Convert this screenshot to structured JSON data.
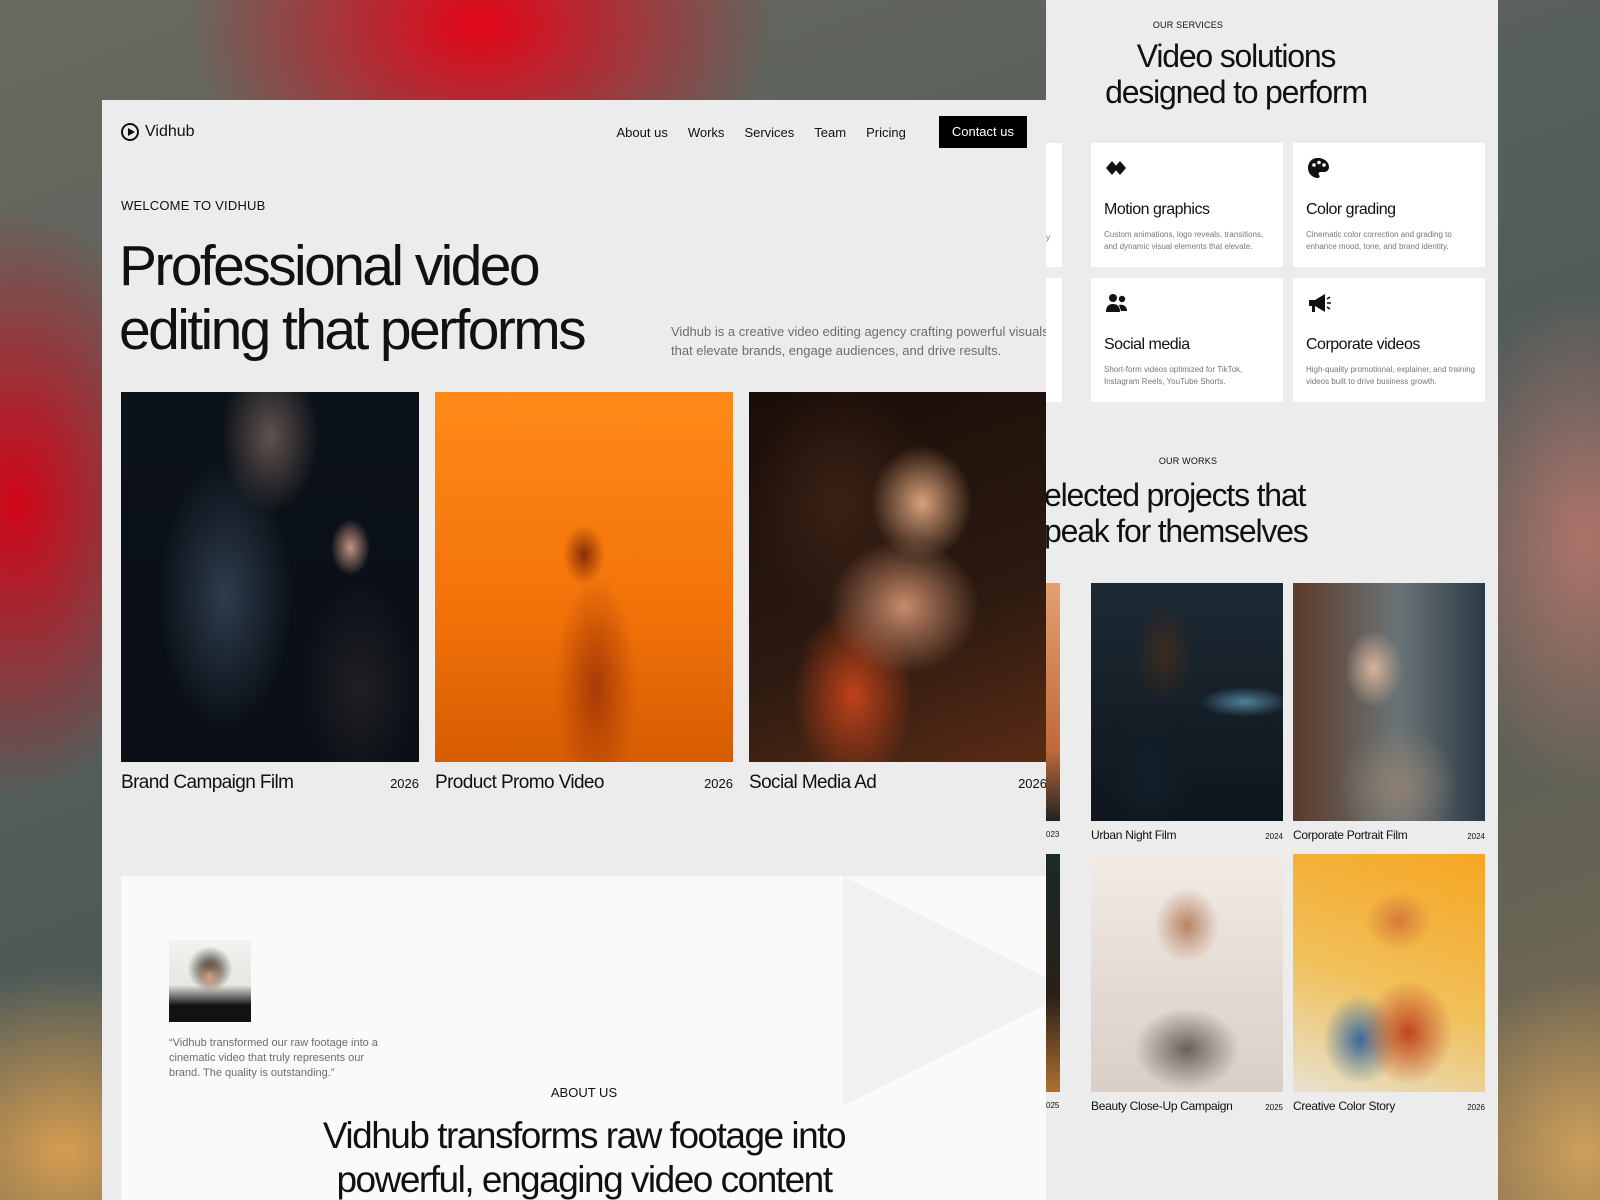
{
  "nav": {
    "brand": "Vidhub",
    "links": [
      "About us",
      "Works",
      "Services",
      "Team",
      "Pricing"
    ],
    "cta": "Contact us"
  },
  "hero": {
    "eyebrow": "WELCOME TO VIDHUB",
    "title_line1": "Professional video",
    "title_line2": "editing that performs",
    "description": "Vidhub is a creative video editing agency crafting powerful visuals that elevate brands, engage audiences, and drive results."
  },
  "works": [
    {
      "title": "Brand Campaign Film",
      "year": "2026"
    },
    {
      "title": "Product Promo Video",
      "year": "2026"
    },
    {
      "title": "Social Media Ad",
      "year": "2026"
    }
  ],
  "about": {
    "quote": "“Vidhub transformed our raw footage into a cinematic video that truly represents our brand. The quality is outstanding.”",
    "eyebrow": "ABOUT US",
    "title_line1": "Vidhub transforms raw footage into",
    "title_line2": "powerful, engaging video content"
  },
  "services": {
    "eyebrow": "OUR SERVICES",
    "title_line1": "Video solutions",
    "title_line2": "designed to perform",
    "items": [
      {
        "name": "Motion graphics",
        "desc": "Custom animations, logo reveals, transitions, and dynamic visual elements that elevate.",
        "icon": "motion-graphics-icon"
      },
      {
        "name": "Color grading",
        "desc": "Cinematic color correction and grading to enhance mood, tone, and brand identity.",
        "icon": "palette-icon"
      },
      {
        "name": "Social media",
        "desc": "Short-form videos optimized for TikTok, Instagram Reels, YouTube Shorts.",
        "icon": "people-icon"
      },
      {
        "name": "Corporate videos",
        "desc": "High-quality promotional, explainer, and training videos built to drive business growth.",
        "icon": "megaphone-icon"
      }
    ],
    "stub_text": "y"
  },
  "our_works": {
    "eyebrow": "OUR WORKS",
    "title_line1": "elected projects that",
    "title_line2": "peak for themselves",
    "stub_years": [
      "023",
      "025"
    ],
    "items": [
      {
        "title": "Urban Night Film",
        "year": "2024"
      },
      {
        "title": "Corporate Portrait Film",
        "year": "2024"
      },
      {
        "title": "Beauty Close-Up Campaign",
        "year": "2025"
      },
      {
        "title": "Creative Color Story",
        "year": "2026"
      }
    ]
  }
}
